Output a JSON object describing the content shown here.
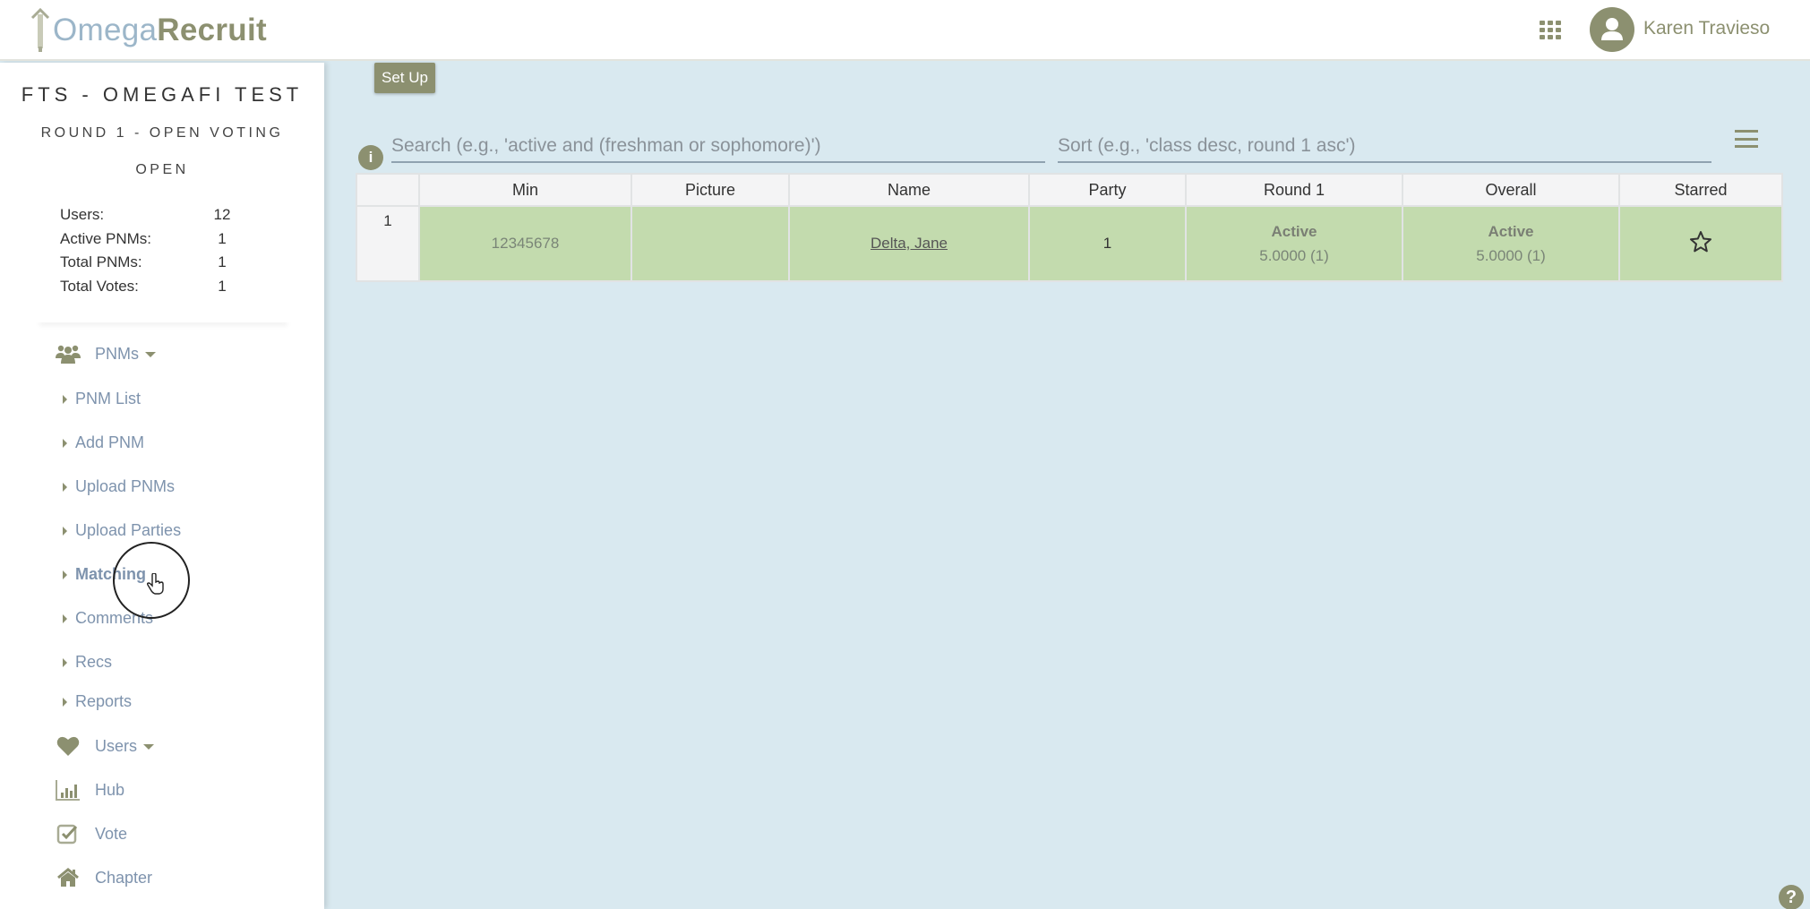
{
  "header": {
    "logo_part1": "Omega",
    "logo_part2": "Recruit",
    "user_name": "Karen Travieso",
    "apps_icon": "grid-icon",
    "avatar_icon": "user-icon"
  },
  "sidebar": {
    "org_title": "FTS - OMEGAFI TEST",
    "round_title": "ROUND 1 - OPEN VOTING",
    "round_status": "OPEN",
    "stats": [
      {
        "label": "Users:",
        "value": "12"
      },
      {
        "label": "Active PNMs:",
        "value": "1"
      },
      {
        "label": "Total PNMs:",
        "value": "1"
      },
      {
        "label": "Total Votes:",
        "value": "1"
      }
    ],
    "nav": {
      "pnms": {
        "label": "PNMs",
        "icon": "users-icon"
      },
      "pnm_sub": [
        {
          "label": "PNM List"
        },
        {
          "label": "Add PNM"
        },
        {
          "label": "Upload PNMs"
        },
        {
          "label": "Upload Parties"
        },
        {
          "label": "Matching",
          "active": true
        },
        {
          "label": "Comments"
        },
        {
          "label": "Recs"
        },
        {
          "label": "Reports"
        }
      ],
      "users": {
        "label": "Users",
        "icon": "heart-icon"
      },
      "hub": {
        "label": "Hub",
        "icon": "bar-chart-icon"
      },
      "vote": {
        "label": "Vote",
        "icon": "checkbox-icon"
      },
      "chapter": {
        "label": "Chapter",
        "icon": "home-icon"
      }
    }
  },
  "main": {
    "setup_label": "Set Up",
    "search_placeholder": "Search (e.g., 'active and (freshman or sophomore)')",
    "sort_placeholder": "Sort (e.g., 'class desc, round 1 asc')",
    "table": {
      "columns": [
        "",
        "Min",
        "Picture",
        "Name",
        "Party",
        "Round 1",
        "Overall",
        "Starred"
      ],
      "rows": [
        {
          "index": "1",
          "min": "12345678",
          "picture": "",
          "name": "Delta, Jane",
          "party": "1",
          "round1_status": "Active",
          "round1_score": "5.0000 (1)",
          "overall_status": "Active",
          "overall_score": "5.0000 (1)",
          "starred": false
        }
      ]
    }
  },
  "colors": {
    "brand_olive": "#8c9070",
    "brand_blue": "#9cb6c9",
    "nav_text": "#7e93ad",
    "main_bg": "#d9e9f0",
    "active_row": "#c3dbae"
  }
}
